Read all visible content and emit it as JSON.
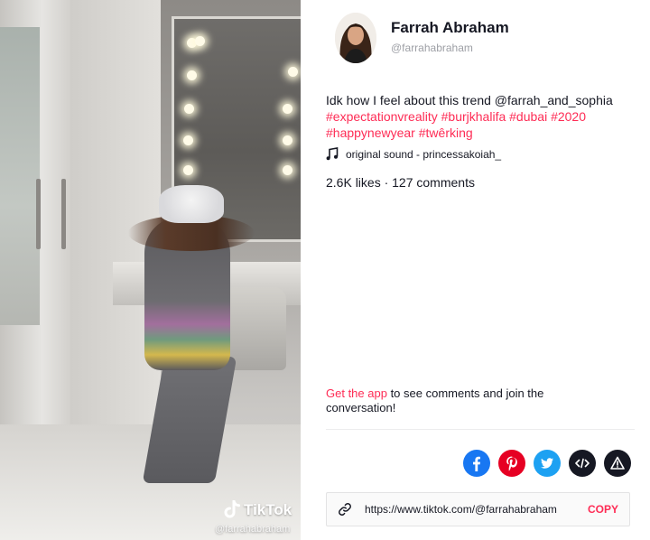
{
  "video": {
    "watermark_brand": "TikTok",
    "watermark_handle": "@farrahabraham"
  },
  "author": {
    "name": "Farrah Abraham",
    "username": "@farrahabraham"
  },
  "caption": {
    "text": "Idk how I feel about this trend @farrah_and_sophia",
    "hashtags": [
      "#expectationvreality",
      "#burjkhalifa",
      "#dubai",
      "#2020",
      "#happynewyear",
      "#twêrking"
    ]
  },
  "music": {
    "icon": "music-note-icon",
    "label": "original sound - princessakoiah_"
  },
  "stats": {
    "text": "2.6K likes · 127 comments"
  },
  "cta": {
    "link_text": "Get the app",
    "rest_text": " to see comments and join the conversation!"
  },
  "share": {
    "items": [
      {
        "name": "facebook",
        "icon": "facebook-icon",
        "color": "#1877f2"
      },
      {
        "name": "pinterest",
        "icon": "pinterest-icon",
        "color": "#e60023"
      },
      {
        "name": "twitter",
        "icon": "twitter-icon",
        "color": "#1da1f2"
      },
      {
        "name": "embed",
        "icon": "embed-code-icon",
        "color": "#161823"
      },
      {
        "name": "report",
        "icon": "warning-icon",
        "color": "#161823"
      }
    ]
  },
  "copy_link": {
    "icon": "link-icon",
    "url": "https://www.tiktok.com/@farrahabraham",
    "button_label": "COPY"
  },
  "colors": {
    "accent": "#fe2c55",
    "text": "#161823",
    "muted": "#9d9fa5"
  }
}
